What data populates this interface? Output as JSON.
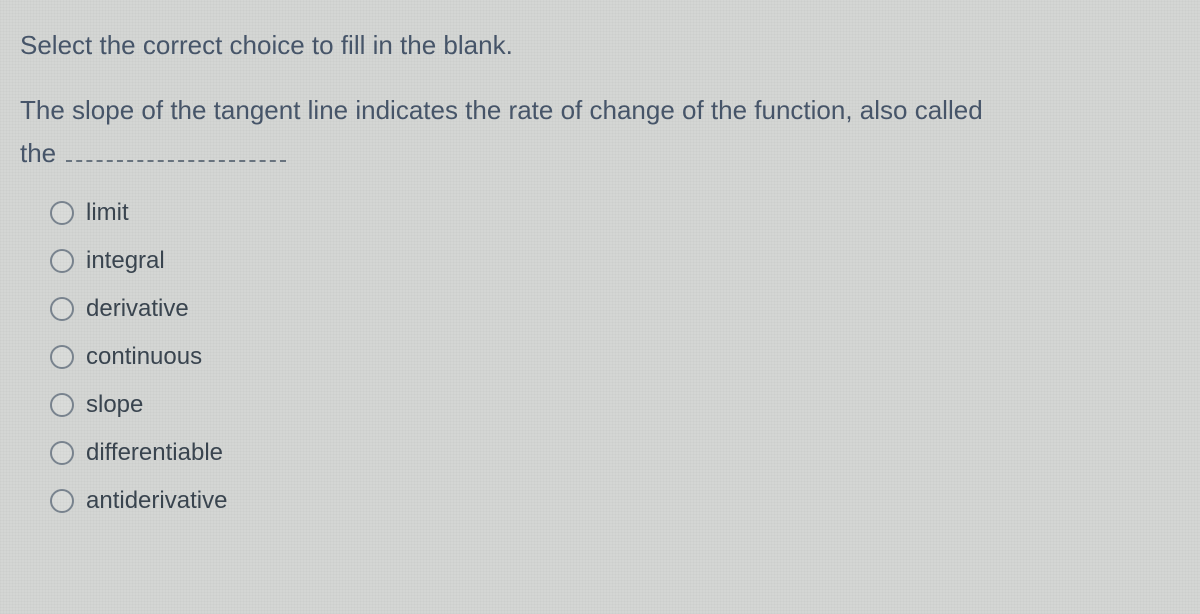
{
  "instruction": "Select the correct choice to fill in the blank.",
  "question": {
    "line1": "The slope of the tangent line indicates the rate of change of the function, also called",
    "line2_prefix": "the"
  },
  "options": [
    {
      "label": "limit"
    },
    {
      "label": "integral"
    },
    {
      "label": "derivative"
    },
    {
      "label": "continuous"
    },
    {
      "label": "slope"
    },
    {
      "label": "differentiable"
    },
    {
      "label": "antiderivative"
    }
  ]
}
